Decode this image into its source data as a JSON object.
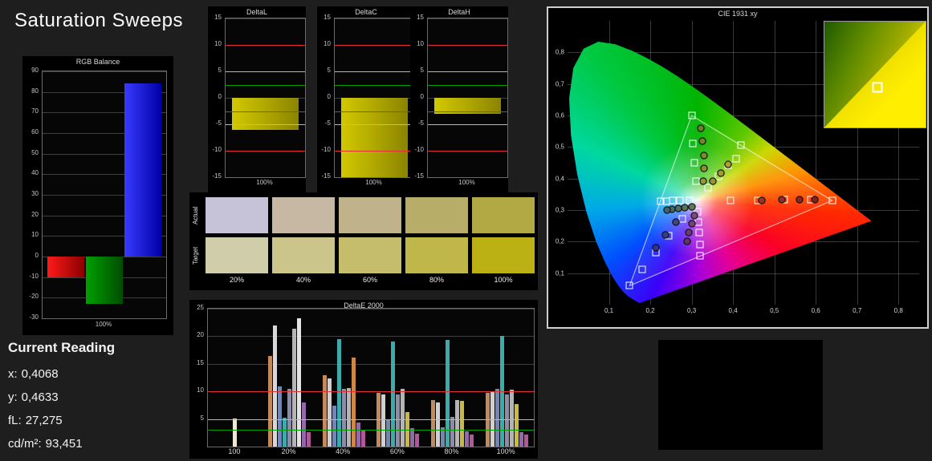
{
  "page": {
    "title": "Saturation Sweeps",
    "background": "#1e1e1e"
  },
  "rgb_balance": {
    "title": "RGB Balance",
    "ymin": -30,
    "ymax": 90,
    "ystep": 10,
    "xlabel": "100%",
    "bars": [
      {
        "name": "red",
        "value": -10,
        "color": "#ff1a1a",
        "color2": "#8a0000"
      },
      {
        "name": "green",
        "value": -23,
        "color": "#00a000",
        "color2": "#004d00"
      },
      {
        "name": "blue",
        "value": 84,
        "color": "#3a3aff",
        "color2": "#0000a8"
      }
    ]
  },
  "delta_charts": {
    "ymin": -15,
    "ymax": 15,
    "ystep": 5,
    "bar_color": "#b0a800",
    "ref_lines": [
      {
        "y": 10,
        "color": "#e23030"
      },
      {
        "y": -10,
        "color": "#e23030"
      },
      {
        "y": 5,
        "color": "#cfcf00"
      },
      {
        "y": -5,
        "color": "#cfcf00"
      },
      {
        "y": 2.5,
        "color": "#00a000"
      },
      {
        "y": -2.5,
        "color": "#00a000"
      }
    ],
    "charts": [
      {
        "title": "DeltaL",
        "value": -6,
        "xlabel": "100%"
      },
      {
        "title": "DeltaC",
        "value": -15,
        "xlabel": "100%"
      },
      {
        "title": "DeltaH",
        "value": -3,
        "xlabel": "100%"
      }
    ]
  },
  "swatches": {
    "row_labels": [
      "Actual",
      "Target"
    ],
    "columns": [
      "20%",
      "40%",
      "60%",
      "80%",
      "100%"
    ],
    "actual": [
      "#c6c3d8",
      "#c6b8a2",
      "#c0b28a",
      "#b8ad68",
      "#b2a844"
    ],
    "target": [
      "#d0cdaa",
      "#cbc48b",
      "#c5bd6b",
      "#bfb74a",
      "#bcb114"
    ]
  },
  "deltae": {
    "title": "DeltaE 2000",
    "ymin": 0,
    "ymax": 25,
    "ystep": 5,
    "ref_lines": [
      {
        "y": 10,
        "color": "#e23030"
      },
      {
        "y": 5,
        "color": "#cfcf00"
      },
      {
        "y": 3,
        "color": "#00a000"
      }
    ],
    "groups": [
      {
        "label": "100",
        "bars": [
          {
            "v": 5.1,
            "c": "#efe8d2"
          }
        ]
      },
      {
        "label": "20%",
        "bars": [
          {
            "v": 16.4,
            "c": "#c28a5a"
          },
          {
            "v": 22.0,
            "c": "#d8d8d8"
          },
          {
            "v": 10.9,
            "c": "#7286b4"
          },
          {
            "v": 5.2,
            "c": "#3aacac"
          },
          {
            "v": 10.4,
            "c": "#8c8ca6"
          },
          {
            "v": 21.4,
            "c": "#b4b4b4"
          },
          {
            "v": 23.3,
            "c": "#e4e4e4"
          },
          {
            "v": 8.0,
            "c": "#9468aa"
          },
          {
            "v": 2.6,
            "c": "#b05898"
          }
        ]
      },
      {
        "label": "40%",
        "bars": [
          {
            "v": 13.0,
            "c": "#c28a5a"
          },
          {
            "v": 12.4,
            "c": "#d0d0d0"
          },
          {
            "v": 7.4,
            "c": "#7286b4"
          },
          {
            "v": 19.5,
            "c": "#3aacac"
          },
          {
            "v": 10.4,
            "c": "#8c8ca6"
          },
          {
            "v": 10.6,
            "c": "#b4b4b4"
          },
          {
            "v": 16.1,
            "c": "#cc8844"
          },
          {
            "v": 4.4,
            "c": "#9468aa"
          },
          {
            "v": 3.0,
            "c": "#b05898"
          }
        ]
      },
      {
        "label": "60%",
        "bars": [
          {
            "v": 9.7,
            "c": "#c28a5a"
          },
          {
            "v": 9.4,
            "c": "#d0d0d0"
          },
          {
            "v": 5.0,
            "c": "#7286b4"
          },
          {
            "v": 19.0,
            "c": "#3aacac"
          },
          {
            "v": 9.4,
            "c": "#8c8ca6"
          },
          {
            "v": 10.5,
            "c": "#b4b4b4"
          },
          {
            "v": 6.3,
            "c": "#ccb844"
          },
          {
            "v": 3.3,
            "c": "#9468aa"
          },
          {
            "v": 2.4,
            "c": "#b05898"
          }
        ]
      },
      {
        "label": "80%",
        "bars": [
          {
            "v": 8.5,
            "c": "#c28a5a"
          },
          {
            "v": 8.0,
            "c": "#d0d0d0"
          },
          {
            "v": 3.5,
            "c": "#7286b4"
          },
          {
            "v": 19.3,
            "c": "#3aacac"
          },
          {
            "v": 5.4,
            "c": "#8c8ca6"
          },
          {
            "v": 8.5,
            "c": "#b4b4b4"
          },
          {
            "v": 8.3,
            "c": "#ccb844"
          },
          {
            "v": 2.8,
            "c": "#9468aa"
          },
          {
            "v": 2.2,
            "c": "#b05898"
          }
        ]
      },
      {
        "label": "100%",
        "bars": [
          {
            "v": 9.7,
            "c": "#c28a5a"
          },
          {
            "v": 10.0,
            "c": "#d0d0d0"
          },
          {
            "v": 10.5,
            "c": "#7286b4"
          },
          {
            "v": 20.0,
            "c": "#3aacac"
          },
          {
            "v": 9.4,
            "c": "#8c8ca6"
          },
          {
            "v": 10.3,
            "c": "#b4b4b4"
          },
          {
            "v": 7.7,
            "c": "#ccb844"
          },
          {
            "v": 2.6,
            "c": "#9468aa"
          },
          {
            "v": 2.2,
            "c": "#b05898"
          }
        ]
      }
    ]
  },
  "cie": {
    "title": "CIE 1931 xy",
    "xmax": 0.85,
    "ymax": 0.9,
    "tick_step": 0.1,
    "xticks": [
      "0,1",
      "0,2",
      "0,3",
      "0,4",
      "0,5",
      "0,6",
      "0,7",
      "0,8"
    ],
    "yticks": [
      "0,1",
      "0,2",
      "0,3",
      "0,4",
      "0,5",
      "0,6",
      "0,7",
      "0,8"
    ],
    "white_point": [
      0.3127,
      0.329
    ],
    "gamut": [
      [
        0.64,
        0.33
      ],
      [
        0.3,
        0.6
      ],
      [
        0.15,
        0.06
      ]
    ],
    "locus": [
      [
        0.1741,
        0.005
      ],
      [
        0.1566,
        0.0177
      ],
      [
        0.144,
        0.0297
      ],
      [
        0.1355,
        0.0399
      ],
      [
        0.1241,
        0.0578
      ],
      [
        0.1096,
        0.0868
      ],
      [
        0.0913,
        0.1327
      ],
      [
        0.0687,
        0.2007
      ],
      [
        0.0454,
        0.295
      ],
      [
        0.0235,
        0.4127
      ],
      [
        0.0082,
        0.5384
      ],
      [
        0.0039,
        0.6548
      ],
      [
        0.0139,
        0.7502
      ],
      [
        0.0389,
        0.812
      ],
      [
        0.0743,
        0.8338
      ],
      [
        0.1142,
        0.8262
      ],
      [
        0.1547,
        0.8059
      ],
      [
        0.1929,
        0.7816
      ],
      [
        0.2296,
        0.7543
      ],
      [
        0.2658,
        0.7243
      ],
      [
        0.3016,
        0.6923
      ],
      [
        0.3373,
        0.6589
      ],
      [
        0.3731,
        0.6245
      ],
      [
        0.4087,
        0.5896
      ],
      [
        0.4441,
        0.5547
      ],
      [
        0.4788,
        0.5202
      ],
      [
        0.5125,
        0.4866
      ],
      [
        0.5448,
        0.4544
      ],
      [
        0.5752,
        0.4242
      ],
      [
        0.6029,
        0.3965
      ],
      [
        0.627,
        0.3725
      ],
      [
        0.6482,
        0.3514
      ],
      [
        0.6658,
        0.334
      ],
      [
        0.6801,
        0.3197
      ],
      [
        0.6915,
        0.3083
      ],
      [
        0.7006,
        0.2993
      ],
      [
        0.7079,
        0.292
      ],
      [
        0.719,
        0.2809
      ],
      [
        0.7347,
        0.2653
      ]
    ],
    "squares": [
      [
        0.295,
        0.33
      ],
      [
        0.272,
        0.33
      ],
      [
        0.254,
        0.33
      ],
      [
        0.238,
        0.329
      ],
      [
        0.225,
        0.329
      ],
      [
        0.394,
        0.33
      ],
      [
        0.459,
        0.331
      ],
      [
        0.524,
        0.332
      ],
      [
        0.588,
        0.332
      ],
      [
        0.64,
        0.33
      ],
      [
        0.31,
        0.392
      ],
      [
        0.307,
        0.45
      ],
      [
        0.303,
        0.51
      ],
      [
        0.3,
        0.6
      ],
      [
        0.34,
        0.372
      ],
      [
        0.364,
        0.406
      ],
      [
        0.388,
        0.442
      ],
      [
        0.407,
        0.463
      ],
      [
        0.419,
        0.505
      ],
      [
        0.315,
        0.296
      ],
      [
        0.317,
        0.262
      ],
      [
        0.319,
        0.228
      ],
      [
        0.32,
        0.19
      ],
      [
        0.321,
        0.154
      ],
      [
        0.277,
        0.272
      ],
      [
        0.245,
        0.218
      ],
      [
        0.213,
        0.164
      ],
      [
        0.181,
        0.111
      ],
      [
        0.15,
        0.062
      ]
    ],
    "circles": [
      {
        "p": [
          0.322,
          0.56
        ],
        "c": "#6d7f2a"
      },
      {
        "p": [
          0.3265,
          0.518
        ],
        "c": "#77842c"
      },
      {
        "p": [
          0.329,
          0.474
        ],
        "c": "#828a2e"
      },
      {
        "p": [
          0.33,
          0.432
        ],
        "c": "#8c9030"
      },
      {
        "p": [
          0.328,
          0.392
        ],
        "c": "#979632"
      },
      {
        "p": [
          0.352,
          0.392
        ],
        "c": "#9a9434"
      },
      {
        "p": [
          0.371,
          0.418
        ],
        "c": "#a49c30"
      },
      {
        "p": [
          0.389,
          0.444
        ],
        "c": "#aaa42c"
      },
      {
        "p": [
          0.3,
          0.309
        ],
        "c": "#5d7a52"
      },
      {
        "p": [
          0.283,
          0.307
        ],
        "c": "#54755a"
      },
      {
        "p": [
          0.267,
          0.305
        ],
        "c": "#4b7062"
      },
      {
        "p": [
          0.252,
          0.303
        ],
        "c": "#426b6a"
      },
      {
        "p": [
          0.24,
          0.301
        ],
        "c": "#3a6672"
      },
      {
        "p": [
          0.47,
          0.331
        ],
        "c": "#94342a"
      },
      {
        "p": [
          0.519,
          0.332
        ],
        "c": "#8e2e26"
      },
      {
        "p": [
          0.561,
          0.333
        ],
        "c": "#882822"
      },
      {
        "p": [
          0.598,
          0.334
        ],
        "c": "#82221e"
      },
      {
        "p": [
          0.306,
          0.283
        ],
        "c": "#7a4a7c"
      },
      {
        "p": [
          0.3,
          0.256
        ],
        "c": "#714376"
      },
      {
        "p": [
          0.294,
          0.229
        ],
        "c": "#683c70"
      },
      {
        "p": [
          0.289,
          0.201
        ],
        "c": "#5f356a"
      },
      {
        "p": [
          0.262,
          0.263
        ],
        "c": "#44457e"
      },
      {
        "p": [
          0.237,
          0.221
        ],
        "c": "#3b3c84"
      },
      {
        "p": [
          0.213,
          0.18
        ],
        "c": "#32338a"
      }
    ],
    "inset": {
      "marker": [
        0.52,
        0.62
      ]
    }
  },
  "current_reading": {
    "title": "Current Reading",
    "items": [
      {
        "label": "x:",
        "value": "0,4068"
      },
      {
        "label": "y:",
        "value": "0,4633"
      },
      {
        "label": "fL:",
        "value": "27,275"
      },
      {
        "label": "cd/m²:",
        "value": "93,451"
      }
    ]
  }
}
